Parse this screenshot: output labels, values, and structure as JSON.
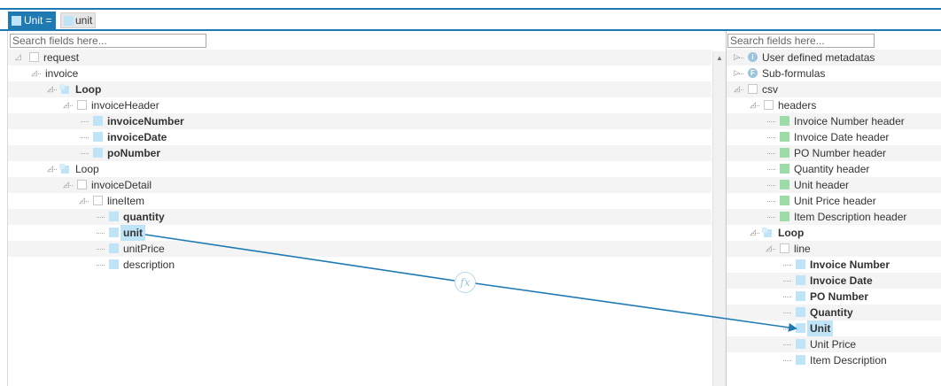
{
  "formula_bar": {
    "target_label": "Unit =",
    "expression_token": "unit"
  },
  "source_panel": {
    "search_placeholder": "Search fields here...",
    "tree": [
      {
        "label": "request",
        "depth": 0,
        "icon": "empty",
        "bold": false
      },
      {
        "label": "invoice",
        "depth": 1,
        "icon": "none",
        "bold": false
      },
      {
        "label": "Loop",
        "depth": 2,
        "icon": "loop",
        "bold": true
      },
      {
        "label": "invoiceHeader",
        "depth": 3,
        "icon": "empty",
        "bold": false
      },
      {
        "label": "invoiceNumber",
        "depth": 4,
        "icon": "blue",
        "bold": true
      },
      {
        "label": "invoiceDate",
        "depth": 4,
        "icon": "blue",
        "bold": true
      },
      {
        "label": "poNumber",
        "depth": 4,
        "icon": "blue",
        "bold": true
      },
      {
        "label": "Loop",
        "depth": 2,
        "icon": "loop",
        "bold": false
      },
      {
        "label": "invoiceDetail",
        "depth": 3,
        "icon": "empty",
        "bold": false
      },
      {
        "label": "lineItem",
        "depth": 4,
        "icon": "empty",
        "bold": false
      },
      {
        "label": "quantity",
        "depth": 5,
        "icon": "blue",
        "bold": true
      },
      {
        "label": "unit",
        "depth": 5,
        "icon": "blue",
        "bold": true,
        "selected": true
      },
      {
        "label": "unitPrice",
        "depth": 5,
        "icon": "blue",
        "bold": false
      },
      {
        "label": "description",
        "depth": 5,
        "icon": "blue",
        "bold": false
      }
    ]
  },
  "target_panel": {
    "search_placeholder": "Search fields here...",
    "tree": [
      {
        "label": "User defined metadatas",
        "depth": 0,
        "icon": "info",
        "bold": false
      },
      {
        "label": "Sub-formulas",
        "depth": 0,
        "icon": "func",
        "bold": false
      },
      {
        "label": "csv",
        "depth": 0,
        "icon": "empty",
        "bold": false
      },
      {
        "label": "headers",
        "depth": 1,
        "icon": "empty",
        "bold": false
      },
      {
        "label": "Invoice Number header",
        "depth": 2,
        "icon": "green",
        "bold": false
      },
      {
        "label": "Invoice Date header",
        "depth": 2,
        "icon": "green",
        "bold": false
      },
      {
        "label": "PO Number header",
        "depth": 2,
        "icon": "green",
        "bold": false
      },
      {
        "label": "Quantity header",
        "depth": 2,
        "icon": "green",
        "bold": false
      },
      {
        "label": "Unit header",
        "depth": 2,
        "icon": "green",
        "bold": false
      },
      {
        "label": "Unit Price header",
        "depth": 2,
        "icon": "green",
        "bold": false
      },
      {
        "label": "Item Description header",
        "depth": 2,
        "icon": "green",
        "bold": false
      },
      {
        "label": "Loop",
        "depth": 1,
        "icon": "loop",
        "bold": true
      },
      {
        "label": "line",
        "depth": 2,
        "icon": "empty",
        "bold": false
      },
      {
        "label": "Invoice Number",
        "depth": 3,
        "icon": "blue",
        "bold": true
      },
      {
        "label": "Invoice Date",
        "depth": 3,
        "icon": "blue",
        "bold": true
      },
      {
        "label": "PO Number",
        "depth": 3,
        "icon": "blue",
        "bold": true
      },
      {
        "label": "Quantity",
        "depth": 3,
        "icon": "blue",
        "bold": true
      },
      {
        "label": "Unit",
        "depth": 3,
        "icon": "blue",
        "bold": true,
        "selected": true
      },
      {
        "label": "Unit Price",
        "depth": 3,
        "icon": "blue",
        "bold": false
      },
      {
        "label": "Item Description",
        "depth": 3,
        "icon": "blue",
        "bold": false
      }
    ]
  },
  "mapping": {
    "from": "unit",
    "to": "Unit",
    "function_badge": "fx",
    "line_color": "#1f7ab4"
  },
  "colors": {
    "accent": "#1f7ab4",
    "field_blue": "#bfe4f7",
    "header_green": "#9ddca9"
  }
}
